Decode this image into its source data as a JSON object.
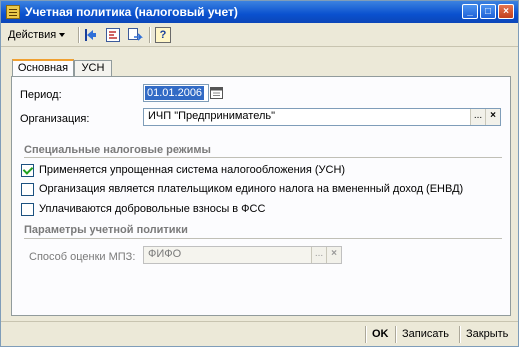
{
  "window": {
    "title": "Учетная политика (налоговый учет)",
    "minimize": "_",
    "maximize": "□",
    "close": "×"
  },
  "toolbar": {
    "actions_label": "Действия",
    "help_label": "?"
  },
  "tabs": [
    {
      "label": "Основная",
      "active": true
    },
    {
      "label": "УСН",
      "active": false
    }
  ],
  "form": {
    "period_label": "Период:",
    "period_value": "01.01.2006",
    "organization_label": "Организация:",
    "organization_value": "ИЧП \"Предприниматель\"",
    "select_btn": "...",
    "clear_btn": "×"
  },
  "tax_regimes": {
    "heading": "Специальные налоговые режимы",
    "items": [
      {
        "label": "Применяется упрощенная система налогообложения (УСН)",
        "checked": true
      },
      {
        "label": "Организация является плательщиком единого налога на вмененный доход (ЕНВД)",
        "checked": false
      },
      {
        "label": "Уплачиваются добровольные взносы в ФСС",
        "checked": false
      }
    ]
  },
  "accounting_policy": {
    "heading": "Параметры учетной политики",
    "mpz_label": "Способ оценки МПЗ:",
    "mpz_value": "ФИФО"
  },
  "footer": {
    "ok_label": "OK",
    "save_label": "Записать",
    "close_label": "Закрыть"
  },
  "colors": {
    "titlebar": "#0a51cf",
    "selection": "#316ac5",
    "tab_accent": "#f0a030",
    "check": "#21a121"
  }
}
